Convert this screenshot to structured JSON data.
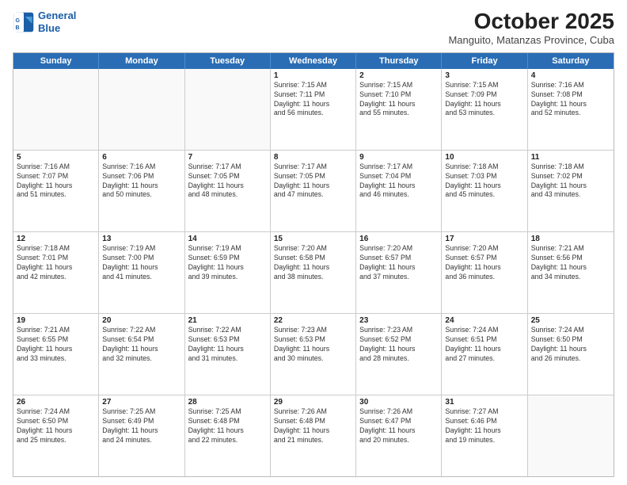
{
  "header": {
    "logo_line1": "General",
    "logo_line2": "Blue",
    "month": "October 2025",
    "location": "Manguito, Matanzas Province, Cuba"
  },
  "weekdays": [
    "Sunday",
    "Monday",
    "Tuesday",
    "Wednesday",
    "Thursday",
    "Friday",
    "Saturday"
  ],
  "weeks": [
    [
      {
        "day": "",
        "info": ""
      },
      {
        "day": "",
        "info": ""
      },
      {
        "day": "",
        "info": ""
      },
      {
        "day": "1",
        "info": "Sunrise: 7:15 AM\nSunset: 7:11 PM\nDaylight: 11 hours\nand 56 minutes."
      },
      {
        "day": "2",
        "info": "Sunrise: 7:15 AM\nSunset: 7:10 PM\nDaylight: 11 hours\nand 55 minutes."
      },
      {
        "day": "3",
        "info": "Sunrise: 7:15 AM\nSunset: 7:09 PM\nDaylight: 11 hours\nand 53 minutes."
      },
      {
        "day": "4",
        "info": "Sunrise: 7:16 AM\nSunset: 7:08 PM\nDaylight: 11 hours\nand 52 minutes."
      }
    ],
    [
      {
        "day": "5",
        "info": "Sunrise: 7:16 AM\nSunset: 7:07 PM\nDaylight: 11 hours\nand 51 minutes."
      },
      {
        "day": "6",
        "info": "Sunrise: 7:16 AM\nSunset: 7:06 PM\nDaylight: 11 hours\nand 50 minutes."
      },
      {
        "day": "7",
        "info": "Sunrise: 7:17 AM\nSunset: 7:05 PM\nDaylight: 11 hours\nand 48 minutes."
      },
      {
        "day": "8",
        "info": "Sunrise: 7:17 AM\nSunset: 7:05 PM\nDaylight: 11 hours\nand 47 minutes."
      },
      {
        "day": "9",
        "info": "Sunrise: 7:17 AM\nSunset: 7:04 PM\nDaylight: 11 hours\nand 46 minutes."
      },
      {
        "day": "10",
        "info": "Sunrise: 7:18 AM\nSunset: 7:03 PM\nDaylight: 11 hours\nand 45 minutes."
      },
      {
        "day": "11",
        "info": "Sunrise: 7:18 AM\nSunset: 7:02 PM\nDaylight: 11 hours\nand 43 minutes."
      }
    ],
    [
      {
        "day": "12",
        "info": "Sunrise: 7:18 AM\nSunset: 7:01 PM\nDaylight: 11 hours\nand 42 minutes."
      },
      {
        "day": "13",
        "info": "Sunrise: 7:19 AM\nSunset: 7:00 PM\nDaylight: 11 hours\nand 41 minutes."
      },
      {
        "day": "14",
        "info": "Sunrise: 7:19 AM\nSunset: 6:59 PM\nDaylight: 11 hours\nand 39 minutes."
      },
      {
        "day": "15",
        "info": "Sunrise: 7:20 AM\nSunset: 6:58 PM\nDaylight: 11 hours\nand 38 minutes."
      },
      {
        "day": "16",
        "info": "Sunrise: 7:20 AM\nSunset: 6:57 PM\nDaylight: 11 hours\nand 37 minutes."
      },
      {
        "day": "17",
        "info": "Sunrise: 7:20 AM\nSunset: 6:57 PM\nDaylight: 11 hours\nand 36 minutes."
      },
      {
        "day": "18",
        "info": "Sunrise: 7:21 AM\nSunset: 6:56 PM\nDaylight: 11 hours\nand 34 minutes."
      }
    ],
    [
      {
        "day": "19",
        "info": "Sunrise: 7:21 AM\nSunset: 6:55 PM\nDaylight: 11 hours\nand 33 minutes."
      },
      {
        "day": "20",
        "info": "Sunrise: 7:22 AM\nSunset: 6:54 PM\nDaylight: 11 hours\nand 32 minutes."
      },
      {
        "day": "21",
        "info": "Sunrise: 7:22 AM\nSunset: 6:53 PM\nDaylight: 11 hours\nand 31 minutes."
      },
      {
        "day": "22",
        "info": "Sunrise: 7:23 AM\nSunset: 6:53 PM\nDaylight: 11 hours\nand 30 minutes."
      },
      {
        "day": "23",
        "info": "Sunrise: 7:23 AM\nSunset: 6:52 PM\nDaylight: 11 hours\nand 28 minutes."
      },
      {
        "day": "24",
        "info": "Sunrise: 7:24 AM\nSunset: 6:51 PM\nDaylight: 11 hours\nand 27 minutes."
      },
      {
        "day": "25",
        "info": "Sunrise: 7:24 AM\nSunset: 6:50 PM\nDaylight: 11 hours\nand 26 minutes."
      }
    ],
    [
      {
        "day": "26",
        "info": "Sunrise: 7:24 AM\nSunset: 6:50 PM\nDaylight: 11 hours\nand 25 minutes."
      },
      {
        "day": "27",
        "info": "Sunrise: 7:25 AM\nSunset: 6:49 PM\nDaylight: 11 hours\nand 24 minutes."
      },
      {
        "day": "28",
        "info": "Sunrise: 7:25 AM\nSunset: 6:48 PM\nDaylight: 11 hours\nand 22 minutes."
      },
      {
        "day": "29",
        "info": "Sunrise: 7:26 AM\nSunset: 6:48 PM\nDaylight: 11 hours\nand 21 minutes."
      },
      {
        "day": "30",
        "info": "Sunrise: 7:26 AM\nSunset: 6:47 PM\nDaylight: 11 hours\nand 20 minutes."
      },
      {
        "day": "31",
        "info": "Sunrise: 7:27 AM\nSunset: 6:46 PM\nDaylight: 11 hours\nand 19 minutes."
      },
      {
        "day": "",
        "info": ""
      }
    ]
  ]
}
